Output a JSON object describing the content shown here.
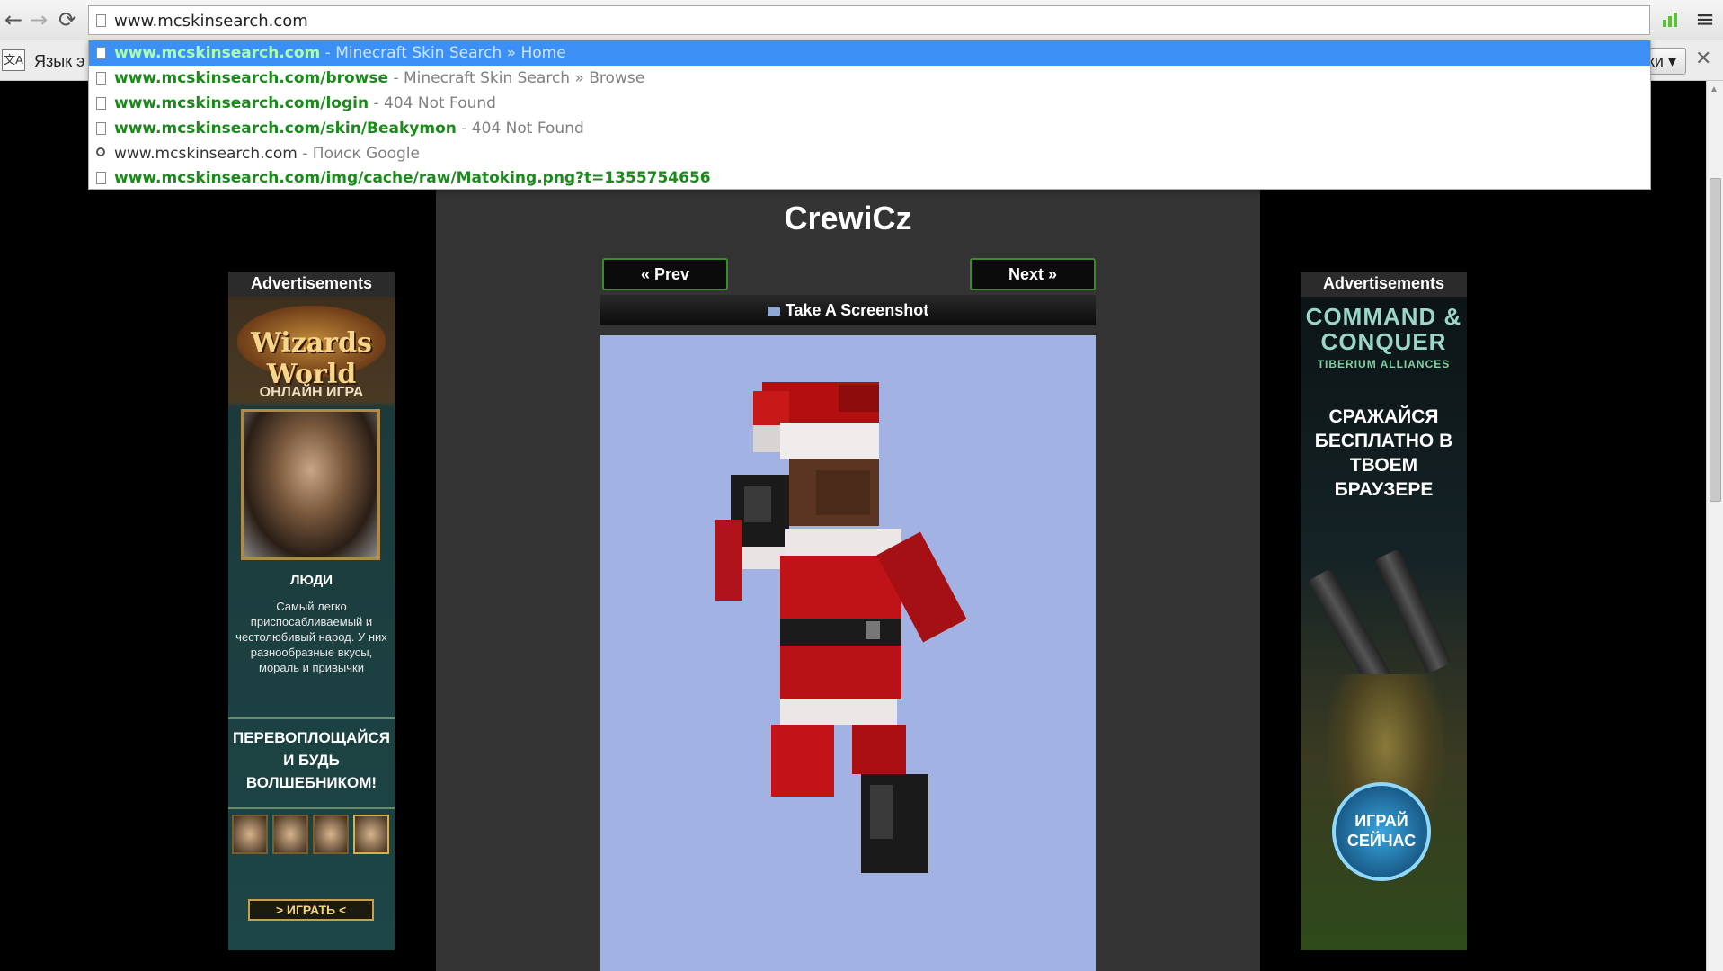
{
  "browser": {
    "back_icon": "←",
    "forward_icon": "→",
    "reload_icon": "⟳",
    "menu_icon": "≡",
    "address": "www.mcskinsearch.com",
    "translate_label": "Язык э",
    "translate_button": "ки ▾",
    "translate_close": "✕",
    "suggestions": [
      {
        "url": "www.mcskinsearch.com",
        "desc": " - Minecraft Skin Search » Home",
        "icon": "page-icon",
        "selected": true
      },
      {
        "url": "www.mcskinsearch.com/browse",
        "desc": " - Minecraft Skin Search » Browse",
        "icon": "page-icon"
      },
      {
        "url": "www.mcskinsearch.com/login",
        "desc": " - 404 Not Found",
        "icon": "page-icon"
      },
      {
        "url": "www.mcskinsearch.com/skin/Beakymon",
        "desc": " - 404 Not Found",
        "icon": "page-icon"
      },
      {
        "query": "www.mcskinsearch.com",
        "desc": " - Поиск Google",
        "icon": "search-icon"
      },
      {
        "url": "www.mcskinsearch.com/img/cache/raw/Matoking.png?t=1355754656",
        "desc": "",
        "icon": "page-icon"
      }
    ]
  },
  "page": {
    "skin_name": "CrewiCz",
    "prev_label": "« Prev",
    "next_label": "Next »",
    "screenshot_label": "Take A Screenshot"
  },
  "ads": {
    "left": {
      "header": "Advertisements",
      "logo": "Wizards World",
      "sub": "ОНЛАЙН ИГРА",
      "people": "ЛЮДИ",
      "desc": "Самый легко приспосабливаемый и честолюбивый народ. У них разнообразные вкусы, мораль и привычки",
      "cta": "ПЕРЕВОПЛОЩАЙСЯ И БУДЬ ВОЛШЕБНИКОМ!",
      "play": "> ИГРАТЬ <"
    },
    "right": {
      "header": "Advertisements",
      "logo": "COMMAND & CONQUER",
      "sub": "TIBERIUM ALLIANCES",
      "text": "СРАЖАЙСЯ БЕСПЛАТНО В ТВОЕМ БРАУЗЕРЕ",
      "play": "ИГРАЙ СЕЙЧАС"
    }
  },
  "colors": {
    "suggestion_selected": "#3c90f5",
    "url_green": "#1a8a1a",
    "page_bg": "#343434",
    "viewer_bg": "#a2b2e2",
    "button_border": "#3b8a2c"
  }
}
